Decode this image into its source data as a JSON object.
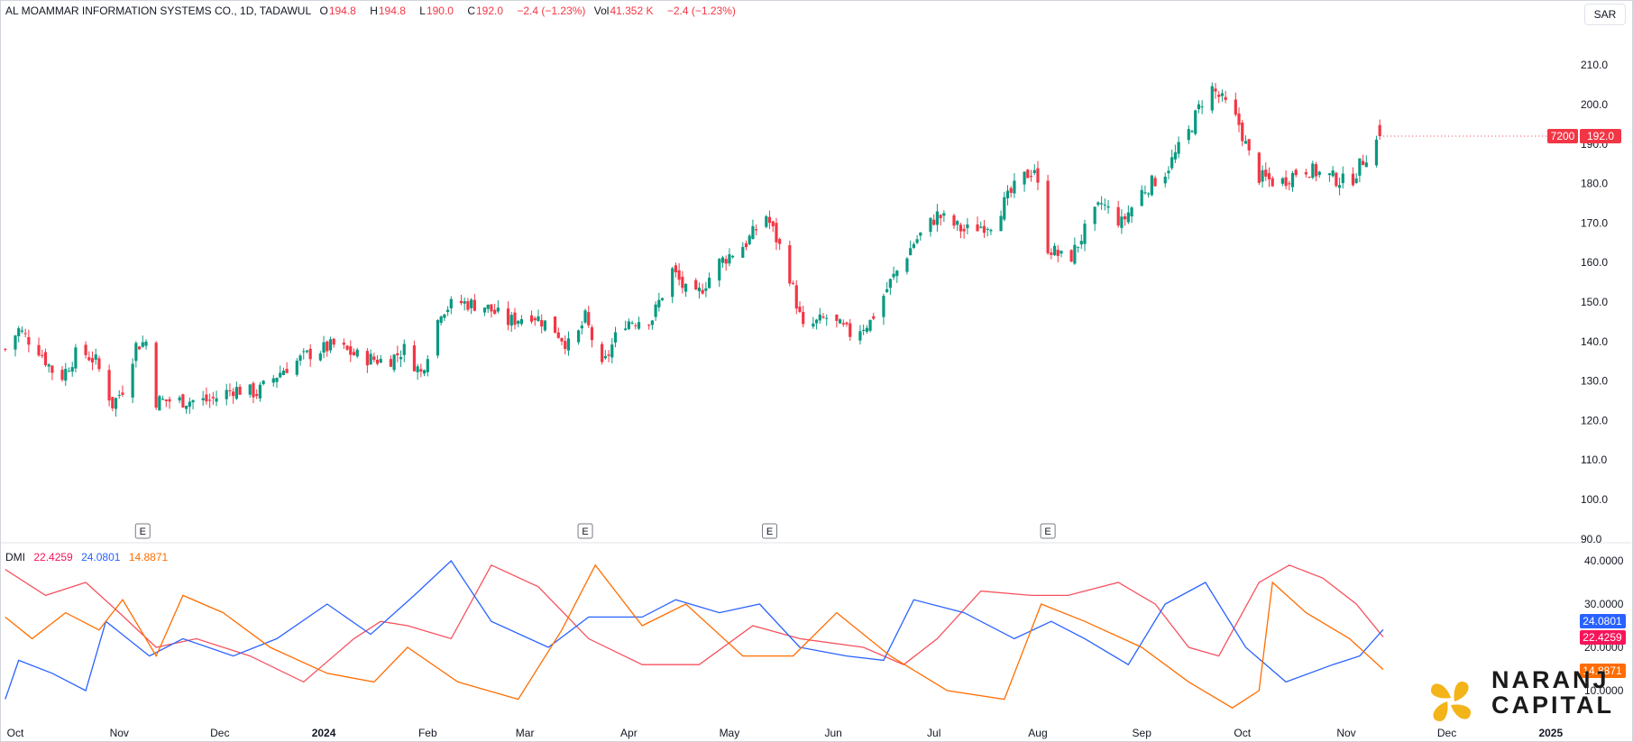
{
  "header": {
    "symbol": "AL MOAMMAR INFORMATION SYSTEMS CO., 1D, TADAWUL",
    "open_key": "O",
    "open": "194.8",
    "high_key": "H",
    "high": "194.8",
    "low_key": "L",
    "low": "190.0",
    "close_key": "C",
    "close": "192.0",
    "change": "−2.4 (−1.23%)",
    "vol_key": "Vol",
    "vol": "41.352 K",
    "vol_change": "−2.4 (−1.23%)"
  },
  "currency": "SAR",
  "colors": {
    "up": "#089981",
    "down": "#f23645",
    "di_plus": "#f7525f",
    "di_minus": "#2962ff",
    "adx": "#ff6d00",
    "di_plus_tag": "#f7145a",
    "di_minus_tag": "#2962ff",
    "adx_tag": "#ff6d00"
  },
  "price_tag": {
    "ticker": "7200",
    "value": "192.0"
  },
  "dmi_legend": {
    "name": "DMI",
    "v1": "22.4259",
    "v2": "24.0801",
    "v3": "14.8871"
  },
  "dmi_tags": {
    "minus": "24.0801",
    "plus": "22.4259",
    "adx": "14.8871"
  },
  "earnings_marker": "E",
  "brand": {
    "line1": "NARANJ",
    "line2": "CAPITAL"
  },
  "chart_data": [
    {
      "type": "candlestick",
      "title": "AL MOAMMAR INFORMATION SYSTEMS CO., 1D, TADAWUL",
      "ylim": [
        90,
        217
      ],
      "y_ticks": [
        "210.0",
        "200.0",
        "190.0",
        "180.0",
        "170.0",
        "160.0",
        "150.0",
        "140.0",
        "130.0",
        "120.0",
        "110.0",
        "100.0",
        "90.0"
      ],
      "x_ticks": [
        "Oct",
        "Nov",
        "Dec",
        "2024",
        "Feb",
        "Mar",
        "Apr",
        "May",
        "Jun",
        "Jul",
        "Aug",
        "Sep",
        "Oct",
        "Nov",
        "Dec",
        "2025"
      ],
      "earnings_dates": [
        "2023-11-08",
        "2024-03-19",
        "2024-05-13",
        "2024-08-04"
      ],
      "close_anchors": [
        [
          "2023-09-28",
          138
        ],
        [
          "2023-10-02",
          143
        ],
        [
          "2023-10-08",
          138
        ],
        [
          "2023-10-14",
          130
        ],
        [
          "2023-10-20",
          138
        ],
        [
          "2023-10-25",
          135
        ],
        [
          "2023-10-30",
          124
        ],
        [
          "2023-11-02",
          128
        ],
        [
          "2023-11-06",
          139
        ],
        [
          "2023-11-09",
          140
        ],
        [
          "2023-11-12",
          125
        ],
        [
          "2023-11-20",
          125
        ],
        [
          "2023-11-28",
          125
        ],
        [
          "2023-12-05",
          128
        ],
        [
          "2023-12-12",
          127
        ],
        [
          "2023-12-20",
          133
        ],
        [
          "2023-12-28",
          137
        ],
        [
          "2024-01-04",
          139
        ],
        [
          "2024-01-12",
          136
        ],
        [
          "2024-01-20",
          135
        ],
        [
          "2024-01-25",
          138
        ],
        [
          "2024-01-30",
          132
        ],
        [
          "2024-02-05",
          148
        ],
        [
          "2024-02-10",
          150
        ],
        [
          "2024-02-18",
          149
        ],
        [
          "2024-02-25",
          145
        ],
        [
          "2024-03-03",
          147
        ],
        [
          "2024-03-10",
          143
        ],
        [
          "2024-03-15",
          138
        ],
        [
          "2024-03-19",
          146
        ],
        [
          "2024-03-24",
          133
        ],
        [
          "2024-03-30",
          145
        ],
        [
          "2024-04-08",
          146
        ],
        [
          "2024-04-14",
          158
        ],
        [
          "2024-04-20",
          150
        ],
        [
          "2024-04-28",
          160
        ],
        [
          "2024-05-06",
          165
        ],
        [
          "2024-05-12",
          172
        ],
        [
          "2024-05-18",
          160
        ],
        [
          "2024-05-23",
          143
        ],
        [
          "2024-05-30",
          146
        ],
        [
          "2024-06-06",
          142
        ],
        [
          "2024-06-12",
          145
        ],
        [
          "2024-06-18",
          155
        ],
        [
          "2024-06-25",
          165
        ],
        [
          "2024-07-02",
          172
        ],
        [
          "2024-07-10",
          168
        ],
        [
          "2024-07-18",
          170
        ],
        [
          "2024-07-26",
          180
        ],
        [
          "2024-07-31",
          184
        ],
        [
          "2024-08-04",
          164
        ],
        [
          "2024-08-10",
          160
        ],
        [
          "2024-08-15",
          168
        ],
        [
          "2024-08-20",
          175
        ],
        [
          "2024-08-26",
          170
        ],
        [
          "2024-09-01",
          178
        ],
        [
          "2024-09-08",
          183
        ],
        [
          "2024-09-15",
          193
        ],
        [
          "2024-09-21",
          205
        ],
        [
          "2024-09-26",
          200
        ],
        [
          "2024-09-30",
          195
        ],
        [
          "2024-10-05",
          182
        ],
        [
          "2024-10-12",
          180
        ],
        [
          "2024-10-19",
          184
        ],
        [
          "2024-10-26",
          182
        ],
        [
          "2024-11-02",
          180
        ],
        [
          "2024-11-06",
          186
        ],
        [
          "2024-11-11",
          192
        ]
      ]
    },
    {
      "type": "line",
      "title": "DMI",
      "ylim": [
        4,
        42
      ],
      "y_ticks": [
        "40.0000",
        "30.0000",
        "20.0000",
        "10.0000"
      ],
      "series": [
        {
          "name": "22.4259",
          "points": [
            [
              "2023-09-28",
              38
            ],
            [
              "2023-10-10",
              32
            ],
            [
              "2023-10-22",
              35
            ],
            [
              "2023-11-01",
              28
            ],
            [
              "2023-11-12",
              20
            ],
            [
              "2023-11-24",
              22
            ],
            [
              "2023-12-10",
              18
            ],
            [
              "2023-12-26",
              12
            ],
            [
              "2024-01-10",
              22
            ],
            [
              "2024-01-18",
              26
            ],
            [
              "2024-01-26",
              25
            ],
            [
              "2024-02-08",
              22
            ],
            [
              "2024-02-20",
              39
            ],
            [
              "2024-03-05",
              34
            ],
            [
              "2024-03-20",
              22
            ],
            [
              "2024-04-05",
              16
            ],
            [
              "2024-04-22",
              16
            ],
            [
              "2024-05-08",
              25
            ],
            [
              "2024-05-22",
              22
            ],
            [
              "2024-06-10",
              20
            ],
            [
              "2024-06-22",
              16
            ],
            [
              "2024-07-02",
              22
            ],
            [
              "2024-07-15",
              33
            ],
            [
              "2024-07-30",
              32
            ],
            [
              "2024-08-10",
              32
            ],
            [
              "2024-08-25",
              35
            ],
            [
              "2024-09-05",
              30
            ],
            [
              "2024-09-15",
              20
            ],
            [
              "2024-09-24",
              18
            ],
            [
              "2024-10-06",
              35
            ],
            [
              "2024-10-15",
              39
            ],
            [
              "2024-10-25",
              36
            ],
            [
              "2024-11-04",
              30
            ],
            [
              "2024-11-12",
              22.4
            ]
          ]
        },
        {
          "name": "24.0801",
          "points": [
            [
              "2023-09-28",
              8
            ],
            [
              "2023-10-02",
              17
            ],
            [
              "2023-10-12",
              14
            ],
            [
              "2023-10-22",
              10
            ],
            [
              "2023-10-28",
              26
            ],
            [
              "2023-11-10",
              18
            ],
            [
              "2023-11-20",
              22
            ],
            [
              "2023-12-05",
              18
            ],
            [
              "2023-12-18",
              22
            ],
            [
              "2024-01-02",
              30
            ],
            [
              "2024-01-15",
              23
            ],
            [
              "2024-01-28",
              32
            ],
            [
              "2024-02-08",
              40
            ],
            [
              "2024-02-20",
              26
            ],
            [
              "2024-03-08",
              20
            ],
            [
              "2024-03-20",
              27
            ],
            [
              "2024-04-05",
              27
            ],
            [
              "2024-04-15",
              31
            ],
            [
              "2024-04-28",
              28
            ],
            [
              "2024-05-10",
              30
            ],
            [
              "2024-05-22",
              20
            ],
            [
              "2024-06-05",
              18
            ],
            [
              "2024-06-16",
              17
            ],
            [
              "2024-06-25",
              31
            ],
            [
              "2024-07-10",
              28
            ],
            [
              "2024-07-25",
              22
            ],
            [
              "2024-08-05",
              26
            ],
            [
              "2024-08-15",
              22
            ],
            [
              "2024-08-28",
              16
            ],
            [
              "2024-09-08",
              30
            ],
            [
              "2024-09-20",
              35
            ],
            [
              "2024-10-02",
              20
            ],
            [
              "2024-10-14",
              12
            ],
            [
              "2024-10-28",
              16
            ],
            [
              "2024-11-05",
              18
            ],
            [
              "2024-11-12",
              24.1
            ]
          ]
        },
        {
          "name": "14.8871",
          "points": [
            [
              "2023-09-28",
              27
            ],
            [
              "2023-10-06",
              22
            ],
            [
              "2023-10-16",
              28
            ],
            [
              "2023-10-26",
              24
            ],
            [
              "2023-11-02",
              31
            ],
            [
              "2023-11-12",
              18
            ],
            [
              "2023-11-20",
              32
            ],
            [
              "2023-12-02",
              28
            ],
            [
              "2023-12-16",
              20
            ],
            [
              "2024-01-02",
              14
            ],
            [
              "2024-01-16",
              12
            ],
            [
              "2024-01-26",
              20
            ],
            [
              "2024-02-10",
              12
            ],
            [
              "2024-02-28",
              8
            ],
            [
              "2024-03-12",
              24
            ],
            [
              "2024-03-22",
              39
            ],
            [
              "2024-04-05",
              25
            ],
            [
              "2024-04-18",
              30
            ],
            [
              "2024-05-05",
              18
            ],
            [
              "2024-05-20",
              18
            ],
            [
              "2024-06-02",
              28
            ],
            [
              "2024-06-18",
              18
            ],
            [
              "2024-07-05",
              10
            ],
            [
              "2024-07-22",
              8
            ],
            [
              "2024-08-02",
              30
            ],
            [
              "2024-08-15",
              26
            ],
            [
              "2024-09-01",
              20
            ],
            [
              "2024-09-15",
              12
            ],
            [
              "2024-09-28",
              6
            ],
            [
              "2024-10-06",
              10
            ],
            [
              "2024-10-10",
              35
            ],
            [
              "2024-10-20",
              28
            ],
            [
              "2024-11-02",
              22
            ],
            [
              "2024-11-12",
              14.9
            ]
          ]
        }
      ]
    }
  ]
}
